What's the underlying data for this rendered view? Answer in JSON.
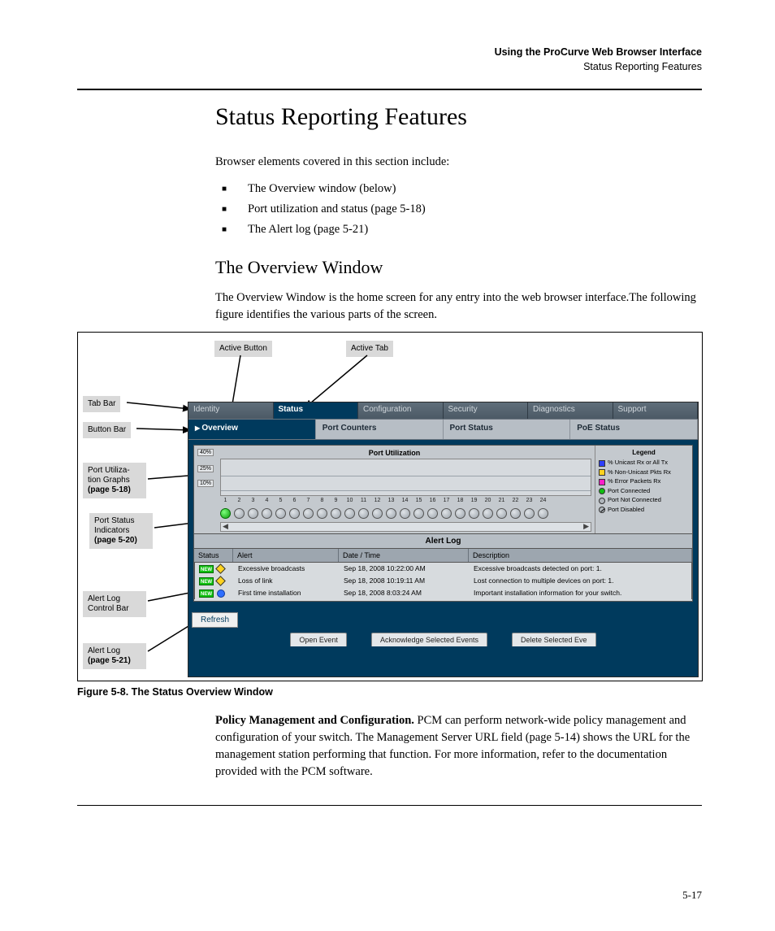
{
  "running_head": {
    "line1": "Using the ProCurve Web Browser Interface",
    "line2": "Status Reporting Features"
  },
  "h1": "Status Reporting Features",
  "intro": "Browser elements covered in this section include:",
  "bullets": [
    "The Overview window (below)",
    "Port utilization and status (page 5-18)",
    "The Alert log (page 5-21)"
  ],
  "h2": "The Overview Window",
  "p2": "The Overview Window is the home screen for any entry into the web browser interface.The following figure identifies the various parts of the screen.",
  "callouts": {
    "active_button": "Active Button",
    "active_tab": "Active Tab",
    "tab_bar": "Tab Bar",
    "button_bar": "Button Bar",
    "port_util": "Port Utiliza-\ntion Graphs\n",
    "port_util_ref": "(page 5-18)",
    "port_status": "Port Status\nIndicators\n",
    "port_status_ref": "(page 5-20)",
    "alert_bar": "Alert Log\nControl Bar",
    "alert_log": "Alert Log\n",
    "alert_log_ref": "(page 5-21)"
  },
  "app": {
    "tabs": [
      "Identity",
      "Status",
      "Configuration",
      "Security",
      "Diagnostics",
      "Support"
    ],
    "active_tab_index": 1,
    "buttons": [
      "Overview",
      "Port Counters",
      "Port Status",
      "PoE Status"
    ],
    "active_button_index": 0,
    "util": {
      "title": "Port Utilization",
      "scales": [
        "40%",
        "25%",
        "10%"
      ],
      "port_count": 24,
      "connected_ports": [
        1
      ],
      "legend_title": "Legend",
      "legend": [
        {
          "swatch": "blue",
          "label": "% Unicast Rx or All Tx"
        },
        {
          "swatch": "yellow",
          "label": "% Non-Unicast Pkts Rx"
        },
        {
          "swatch": "mag",
          "label": "% Error Packets Rx"
        }
      ],
      "legend_status": [
        {
          "dot": "green",
          "label": "Port Connected"
        },
        {
          "dot": "grey",
          "label": "Port Not Connected"
        },
        {
          "dot": "slash",
          "label": "Port Disabled"
        }
      ]
    },
    "alert": {
      "title": "Alert Log",
      "headers": [
        "Status",
        "Alert",
        "Date / Time",
        "Description"
      ],
      "rows": [
        {
          "kind": "warn",
          "alert": "Excessive broadcasts",
          "dt": "Sep 18, 2008 10:22:00 AM",
          "desc": "Excessive broadcasts detected on port: 1."
        },
        {
          "kind": "warn",
          "alert": "Loss of link",
          "dt": "Sep 18, 2008 10:19:11 AM",
          "desc": "Lost connection to multiple devices on port: 1."
        },
        {
          "kind": "info",
          "alert": "First time installation",
          "dt": "Sep 18, 2008 8:03:24 AM",
          "desc": "Important installation information for your switch."
        }
      ],
      "refresh": "Refresh",
      "actions": [
        "Open Event",
        "Acknowledge Selected Events",
        "Delete Selected Eve"
      ]
    }
  },
  "fig_caption": "Figure 5-8.   The Status Overview Window",
  "policy_heading": "Policy Management and Configuration.",
  "policy_body": "   PCM can perform network-wide policy management and configuration of your switch. The Management Server URL field (page 5-14) shows the URL for the management station performing that function. For more information, refer to the documentation provided with the PCM software.",
  "pagenum": "5-17"
}
